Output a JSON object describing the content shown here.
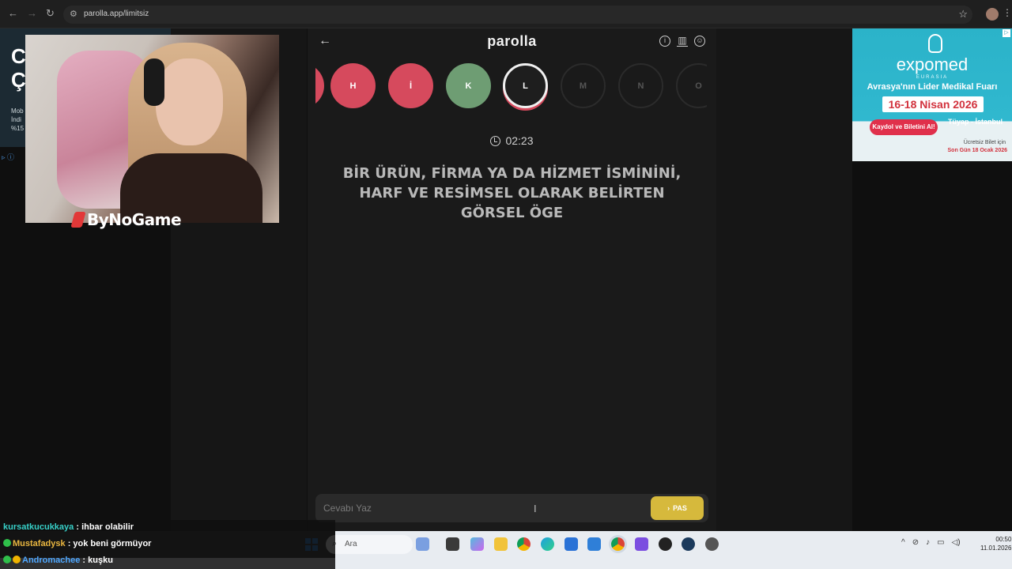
{
  "browser": {
    "url": "parolla.app/limitsiz"
  },
  "left_ad": {
    "headline_line1": "C",
    "headline_line2": "Ç",
    "line1": "Mob",
    "line2": "İndi",
    "line3": "%15"
  },
  "stream": {
    "logo_text": "ByNoGame"
  },
  "game": {
    "title": "parolla",
    "timer": "02:23",
    "letters": [
      {
        "letter": "",
        "state": "red"
      },
      {
        "letter": "H",
        "state": "red"
      },
      {
        "letter": "İ",
        "state": "red"
      },
      {
        "letter": "K",
        "state": "green"
      },
      {
        "letter": "L",
        "state": "current"
      },
      {
        "letter": "M",
        "state": "future"
      },
      {
        "letter": "N",
        "state": "future"
      },
      {
        "letter": "O",
        "state": "future"
      }
    ],
    "question": "BİR ÜRÜN, FİRMA YA DA HİZMET İSMİNİNİ, HARF VE RESİMSEL OLARAK BELİRTEN GÖRSEL ÖGE",
    "answer_placeholder": "Cevabı Yaz",
    "pass_label": "PAS"
  },
  "right_ad": {
    "brand": "expomed",
    "brand_sub": "EURASIA",
    "tagline": "Avrasya'nın Lider Medikal Fuarı",
    "dates": "16-18 Nisan 2026",
    "cta": "Kaydol ve Biletini Al!",
    "venue": "Tüyap - İstanbul",
    "note1": "Ücretsiz Bilet için",
    "note2": "Son Gün 18 Ocak 2026"
  },
  "chat": [
    {
      "user": "kursatkucukkaya",
      "message": ": ihbar olabilir"
    },
    {
      "user": "Mustafadysk",
      "message": ": yok beni görmüyor"
    },
    {
      "user": "Andromachee",
      "message": ": kuşku"
    }
  ],
  "taskbar": {
    "search_label": "Ara",
    "time": "00:50",
    "date": "11.01.2026"
  },
  "colors": {
    "correct": "#6e9d73",
    "wrong": "#d64a5d",
    "pass_button": "#d6b93c"
  }
}
